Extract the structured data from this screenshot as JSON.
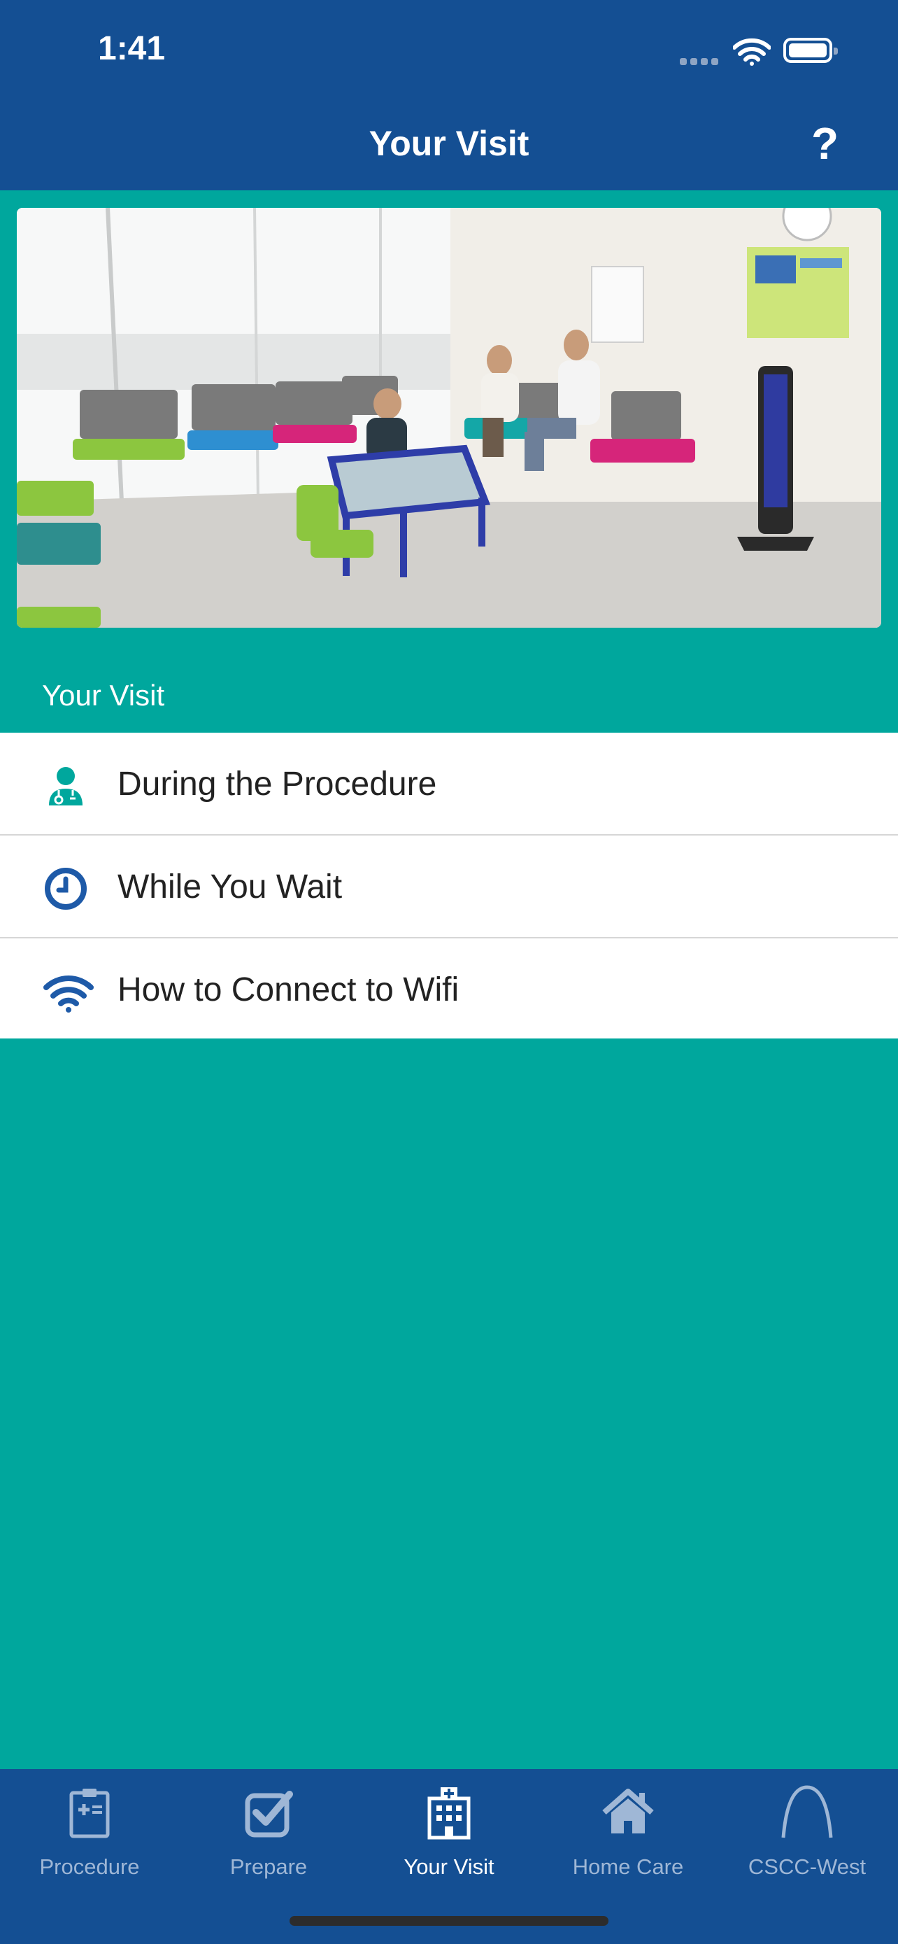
{
  "status_bar": {
    "time": "1:41"
  },
  "nav": {
    "title": "Your Visit",
    "help_label": "?"
  },
  "section": {
    "label": "Your Visit"
  },
  "list_items": [
    {
      "label": "During the Procedure",
      "icon": "doctor-icon"
    },
    {
      "label": "While You Wait",
      "icon": "clock-icon"
    },
    {
      "label": "How to Connect to Wifi",
      "icon": "wifi-icon"
    }
  ],
  "tabs": [
    {
      "label": "Procedure",
      "icon": "clipboard-icon",
      "active": false
    },
    {
      "label": "Prepare",
      "icon": "checkbox-icon",
      "active": false
    },
    {
      "label": "Your Visit",
      "icon": "hospital-icon",
      "active": true
    },
    {
      "label": "Home Care",
      "icon": "home-icon",
      "active": false
    },
    {
      "label": "CSCC-West",
      "icon": "arch-icon",
      "active": false
    }
  ],
  "colors": {
    "nav_blue": "#144F93",
    "teal": "#00A79D",
    "icon_blue": "#1E5AA8",
    "tab_inactive": "#9FB7D6"
  }
}
